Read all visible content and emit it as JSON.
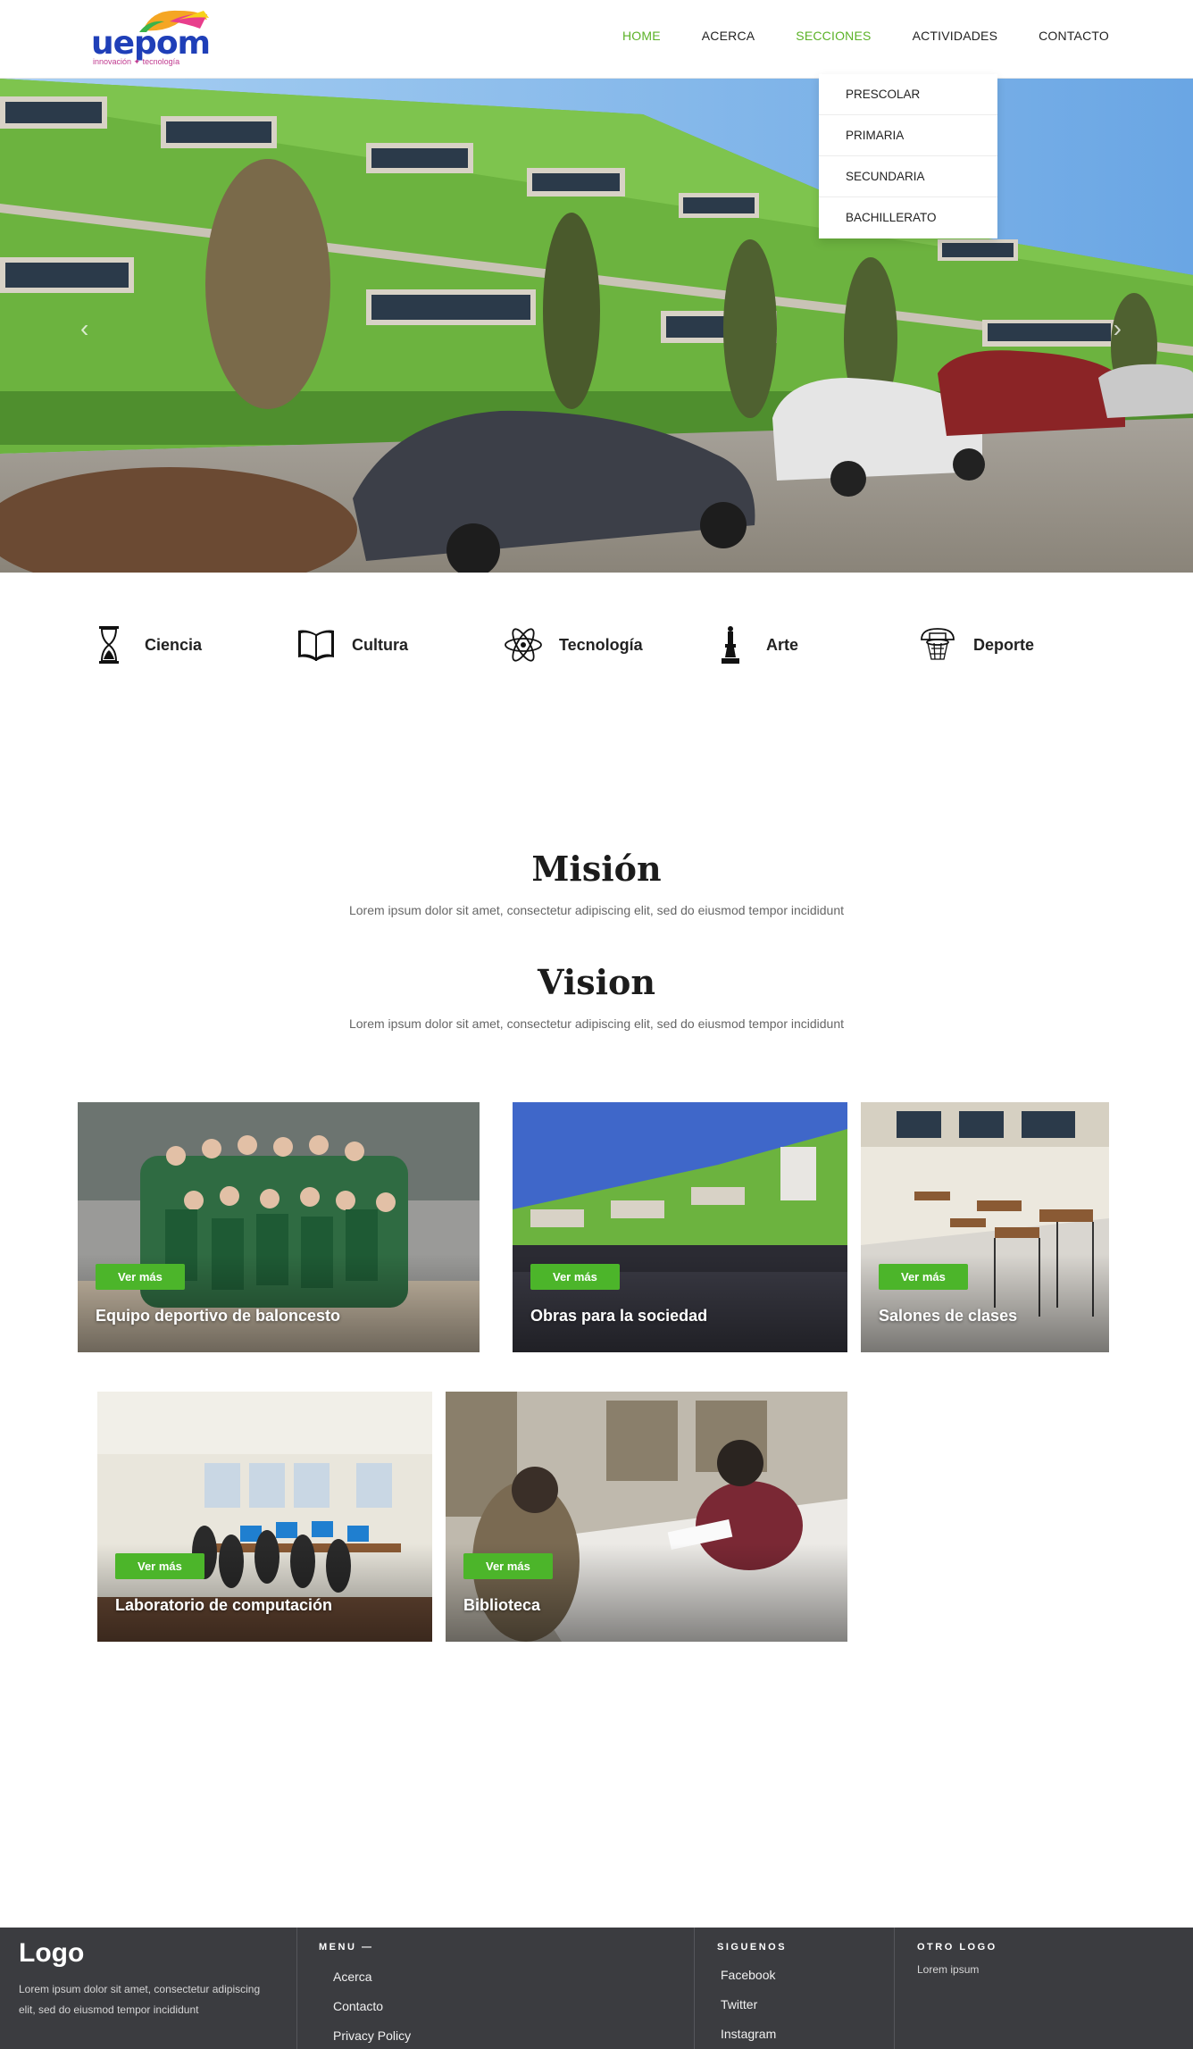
{
  "header": {
    "logo_text": "uepom",
    "logo_tagline": "innovación ✦ tecnología",
    "nav": [
      {
        "label": "HOME"
      },
      {
        "label": "ACERCA"
      },
      {
        "label": "SECCIONES"
      },
      {
        "label": "ACTIVIDADES"
      },
      {
        "label": "CONTACTO"
      }
    ],
    "active_nav": "HOME",
    "open_menu": "SECCIONES",
    "dropdown": [
      "PRESCOLAR",
      "PRIMARIA",
      "SECUNDARIA",
      "BACHILLERATO"
    ]
  },
  "hero": {
    "prev_icon": "chevron-left-icon",
    "next_icon": "chevron-right-icon"
  },
  "features": [
    {
      "label": "Ciencia",
      "icon": "hourglass-icon"
    },
    {
      "label": "Cultura",
      "icon": "book-icon"
    },
    {
      "label": "Tecnología",
      "icon": "atom-icon"
    },
    {
      "label": "Arte",
      "icon": "chess-piece-icon"
    },
    {
      "label": "Deporte",
      "icon": "basketball-hoop-icon"
    }
  ],
  "mission": {
    "title": "Misión",
    "text": "Lorem ipsum dolor sit amet, consectetur adipiscing elit, sed do eiusmod tempor incididunt"
  },
  "vision": {
    "title": "Vision",
    "text": "Lorem ipsum dolor sit amet, consectetur adipiscing elit, sed do eiusmod tempor incididunt"
  },
  "cards": [
    {
      "title": "Equipo deportivo de baloncesto",
      "button": "Ver más"
    },
    {
      "title": "Obras para la sociedad",
      "button": "Ver más"
    },
    {
      "title": "Salones de clases",
      "button": "Ver más"
    },
    {
      "title": "Laboratorio de computación",
      "button": "Ver más"
    },
    {
      "title": "Biblioteca",
      "button": "Ver más"
    }
  ],
  "footer": {
    "logo": "Logo",
    "about_text": "Lorem ipsum dolor sit amet, consectetur adipiscing elit, sed do eiusmod tempor incididunt",
    "menu_heading": "MENU —",
    "menu_links": [
      "Acerca",
      "Contacto",
      "Privacy Policy"
    ],
    "follow_heading": "SIGUENOS",
    "follow_links": [
      "Facebook",
      "Twitter",
      "Instagram"
    ],
    "other_heading": "OTRO LOGO",
    "other_text": "Lorem ipsum"
  },
  "colors": {
    "accent_green": "#4cb52a",
    "nav_active": "#5bb227",
    "footer_bg": "#3b3c40"
  }
}
